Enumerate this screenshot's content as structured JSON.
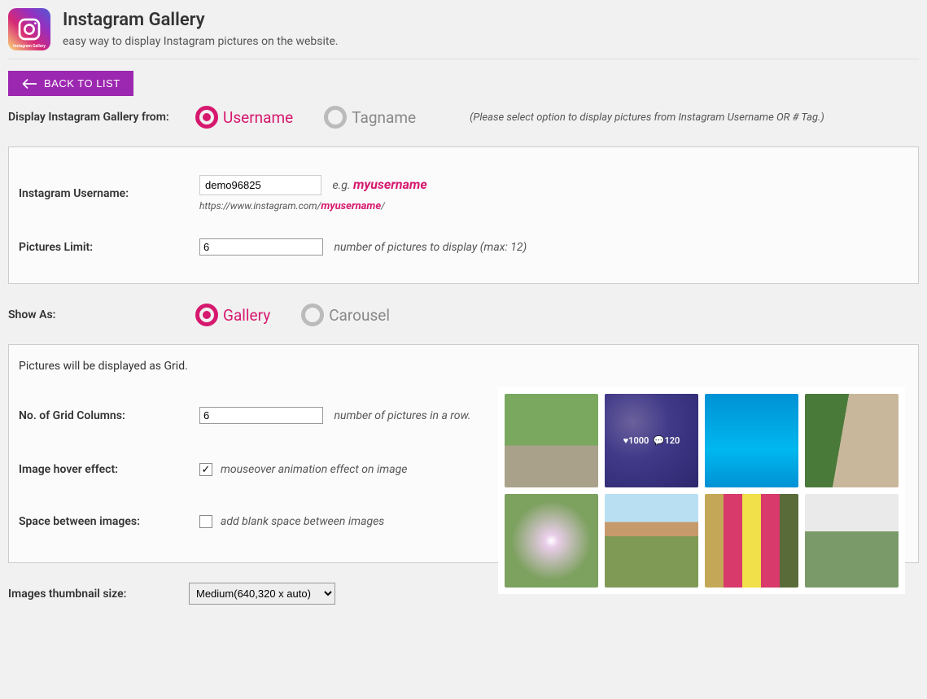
{
  "header": {
    "title": "Instagram Gallery",
    "subtitle": "easy way to display Instagram pictures on the website.",
    "icon_caption": "Instagram Gallery"
  },
  "back_button": {
    "label": "BACK TO LIST"
  },
  "source_section": {
    "label": "Display Instagram Gallery from:",
    "options": {
      "username": "Username",
      "tagname": "Tagname"
    },
    "selected": "username",
    "hint": "(Please select option to display pictures from Instagram Username OR # Tag.)"
  },
  "username_field": {
    "label": "Instagram Username:",
    "value": "demo96825",
    "eg_prefix": "e.g.",
    "eg_value": "myusername",
    "url_prefix": "https://www.instagram.com/",
    "url_highlight": "myusername",
    "url_suffix": "/"
  },
  "limit_field": {
    "label": "Pictures Limit:",
    "value": 6,
    "hint": "number of pictures to display (max: 12)"
  },
  "show_as": {
    "label": "Show As:",
    "options": {
      "gallery": "Gallery",
      "carousel": "Carousel"
    },
    "selected": "gallery"
  },
  "grid_panel": {
    "intro": "Pictures will be displayed as Grid.",
    "columns": {
      "label": "No. of Grid Columns:",
      "value": 6,
      "hint": "number of pictures in a row."
    },
    "hover": {
      "label": "Image hover effect:",
      "checked": true,
      "desc": "mouseover animation effect on image"
    },
    "spacing": {
      "label": "Space between images:",
      "checked": false,
      "desc": "add blank space between images"
    },
    "preview_overlay": {
      "likes": "1000",
      "comments": "120"
    }
  },
  "thumb_size": {
    "label": "Images thumbnail size:",
    "selected": "Medium(640,320 x auto)",
    "options": [
      "Medium(640,320 x auto)"
    ]
  }
}
